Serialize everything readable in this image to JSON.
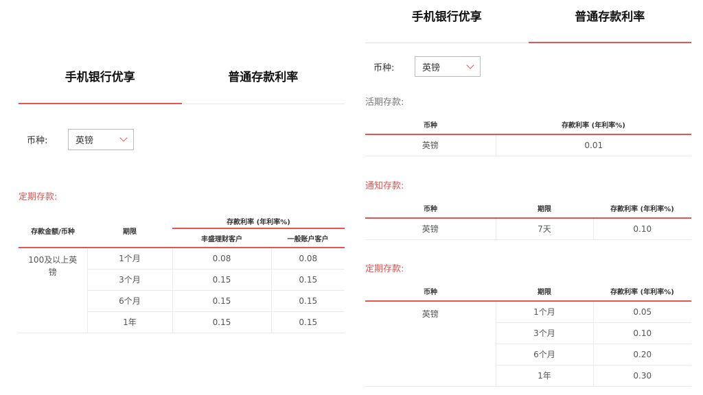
{
  "tabs": [
    "手机银行优享",
    "普通存款利率"
  ],
  "currency": {
    "label": "币种:",
    "selected": "英镑"
  },
  "left": {
    "fixed_title": "定期存款:",
    "headers": {
      "amount": "存款金额/币种",
      "term": "期限",
      "rate_group": "存款利率 (年利率%)",
      "col_a": "丰盛理财客户",
      "col_b": "一般账户客户"
    },
    "amount_value": "100及以上英镑",
    "rows": [
      {
        "term": "1个月",
        "a": "0.08",
        "b": "0.08"
      },
      {
        "term": "3个月",
        "a": "0.15",
        "b": "0.15"
      },
      {
        "term": "6个月",
        "a": "0.15",
        "b": "0.15"
      },
      {
        "term": "1年",
        "a": "0.15",
        "b": "0.15"
      }
    ]
  },
  "right": {
    "demand": {
      "title": "活期存款:",
      "headers": [
        "币种",
        "存款利率 (年利率%)"
      ],
      "row": [
        "英镑",
        "0.01"
      ]
    },
    "notice": {
      "title": "通知存款:",
      "headers": [
        "币种",
        "期限",
        "存款利率 (年利率%)"
      ],
      "row": [
        "英镑",
        "7天",
        "0.10"
      ]
    },
    "fixed": {
      "title": "定期存款:",
      "headers": [
        "币种",
        "期限",
        "存款利率 (年利率%)"
      ],
      "currency": "英镑",
      "rows": [
        {
          "term": "1个月",
          "rate": "0.05"
        },
        {
          "term": "3个月",
          "rate": "0.10"
        },
        {
          "term": "6个月",
          "rate": "0.20"
        },
        {
          "term": "1年",
          "rate": "0.30"
        }
      ]
    }
  },
  "colors": {
    "accent": "#e9524f",
    "divider": "#eaeaea"
  }
}
